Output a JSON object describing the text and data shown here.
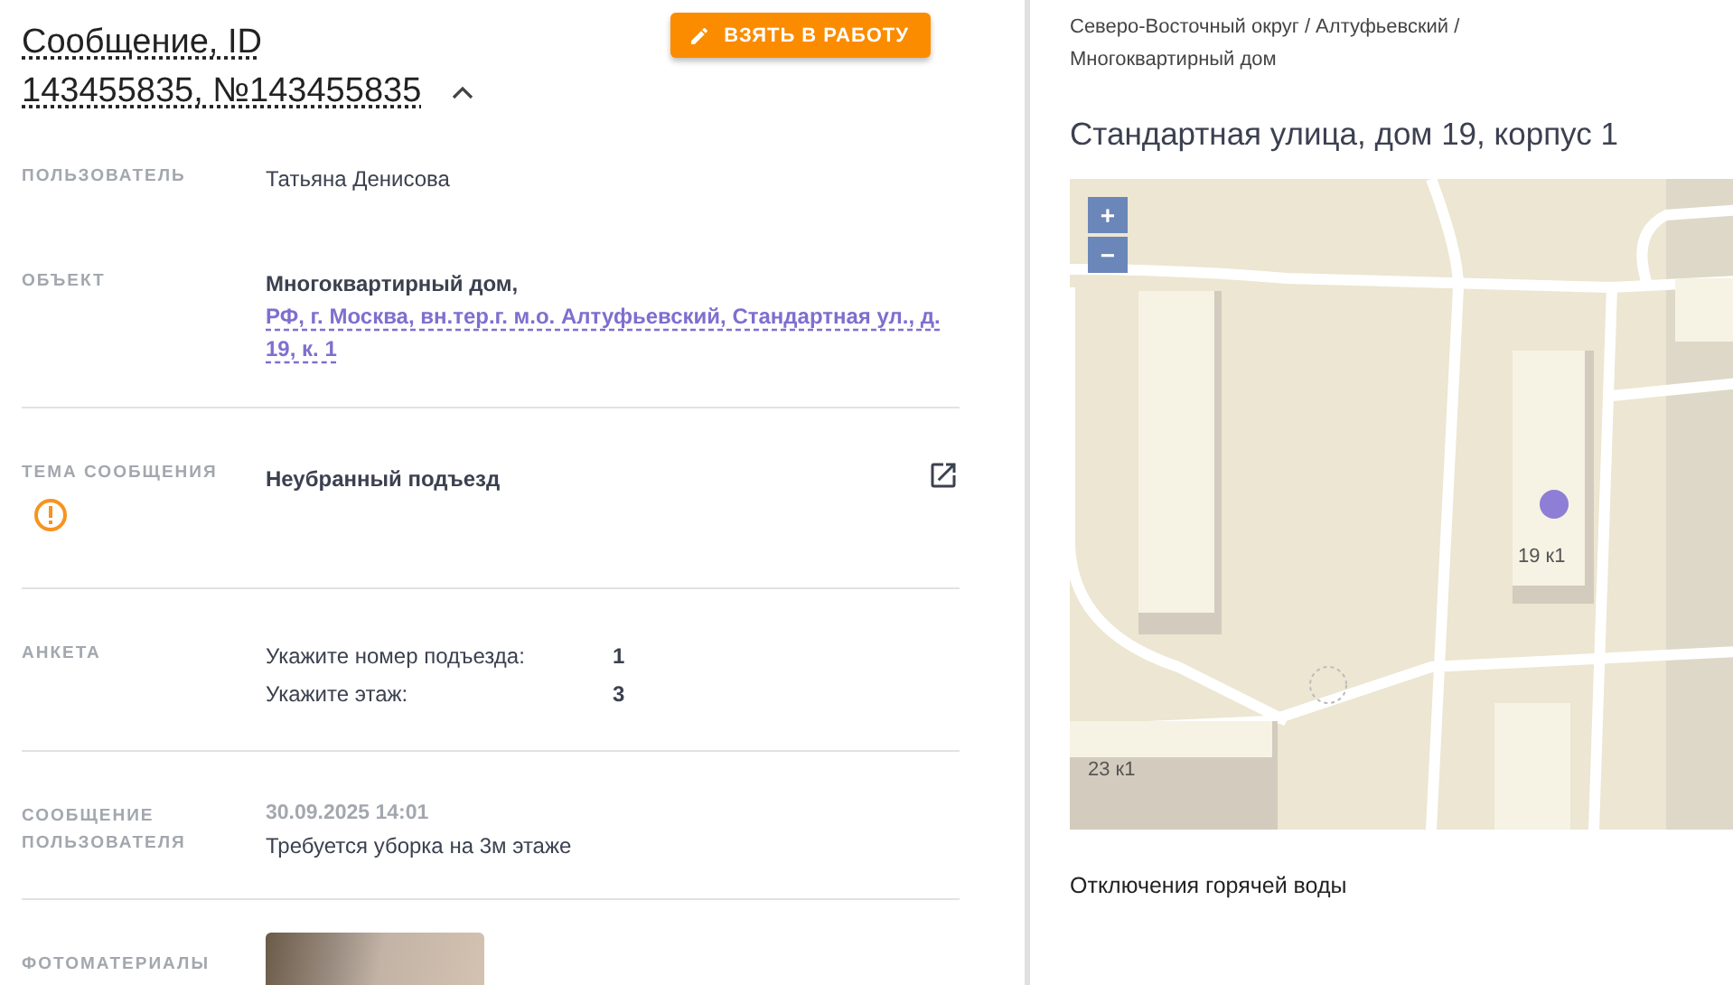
{
  "message": {
    "title": "Сообщение, ID 143455835, №143455835",
    "expanded": true,
    "action_button": "ВЗЯТЬ В РАБОТУ",
    "fields": [
      {
        "kind": "text",
        "label": "ПОЛЬЗОВАТЕЛЬ",
        "value": "Татьяна Денисова"
      },
      {
        "kind": "object",
        "label": "ОБЪЕКТ",
        "value": "Многоквартирный дом,",
        "link": "РФ, г. Москва, вн.тер.г. м.о. Алтуфьевский, Стандартная ул., д. 19, к. 1"
      },
      {
        "kind": "topic",
        "label": "ТЕМА СООБЩЕНИЯ",
        "value": "Неубранный подъезд"
      },
      {
        "kind": "survey",
        "label": "АНКЕТА",
        "items": [
          {
            "question": "Укажите номер подъезда:",
            "answer": "1"
          },
          {
            "question": "Укажите этаж:",
            "answer": "3"
          }
        ]
      },
      {
        "kind": "message",
        "label": "СООБЩЕНИЕ ПОЛЬЗОВАТЕЛЯ",
        "date": "30.09.2025 14:01",
        "value": "Требуется уборка на 3м этаже"
      },
      {
        "kind": "photos",
        "label": "ФОТОМАТЕРИАЛЫ"
      }
    ]
  },
  "object": {
    "breadcrumb": "Северо-Восточный округ / Алтуфьевский / Многоквартирный дом",
    "title": "Стандартная улица, дом 19, корпус 1",
    "map": {
      "zoom_in": "+",
      "zoom_out": "−",
      "labels": [
        "19 к1",
        "23 к1"
      ]
    },
    "section_title": "Отключения горячей воды"
  }
}
